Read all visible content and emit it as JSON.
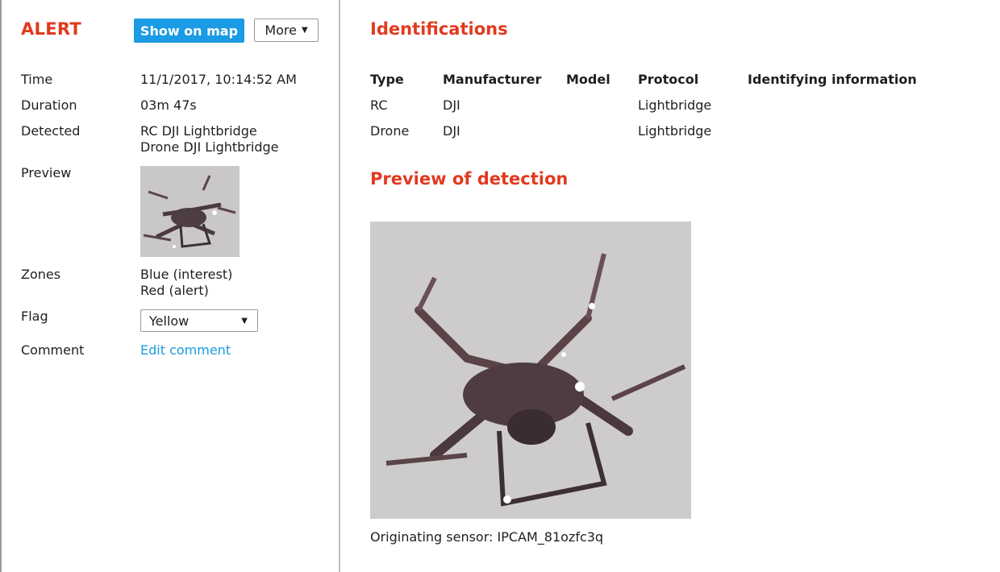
{
  "alert": {
    "title": "ALERT",
    "show_on_map": "Show on map",
    "more": "More",
    "caret": "▼"
  },
  "details": {
    "time_label": "Time",
    "time_value": "11/1/2017, 10:14:52 AM",
    "duration_label": "Duration",
    "duration_value": "03m 47s",
    "detected_label": "Detected",
    "detected_values": [
      "RC DJI Lightbridge",
      "Drone DJI Lightbridge"
    ],
    "preview_label": "Preview",
    "zones_label": "Zones",
    "zones_values": [
      "Blue (interest)",
      "Red (alert)"
    ],
    "flag_label": "Flag",
    "flag_value": "Yellow",
    "comment_label": "Comment",
    "comment_link": "Edit comment"
  },
  "identifications": {
    "title": "Identifications",
    "columns": [
      "Type",
      "Manufacturer",
      "Model",
      "Protocol",
      "Identifying information"
    ],
    "rows": [
      {
        "type": "RC",
        "manufacturer": "DJI",
        "model": "",
        "protocol": "Lightbridge",
        "info": ""
      },
      {
        "type": "Drone",
        "manufacturer": "DJI",
        "model": "",
        "protocol": "Lightbridge",
        "info": ""
      }
    ]
  },
  "preview": {
    "title": "Preview of detection",
    "sensor_text": "Originating sensor: IPCAM_81ozfc3q"
  },
  "colors": {
    "accent_red": "#e13a1f",
    "link_blue": "#1a9be3",
    "divider": "#bdbdbd"
  }
}
